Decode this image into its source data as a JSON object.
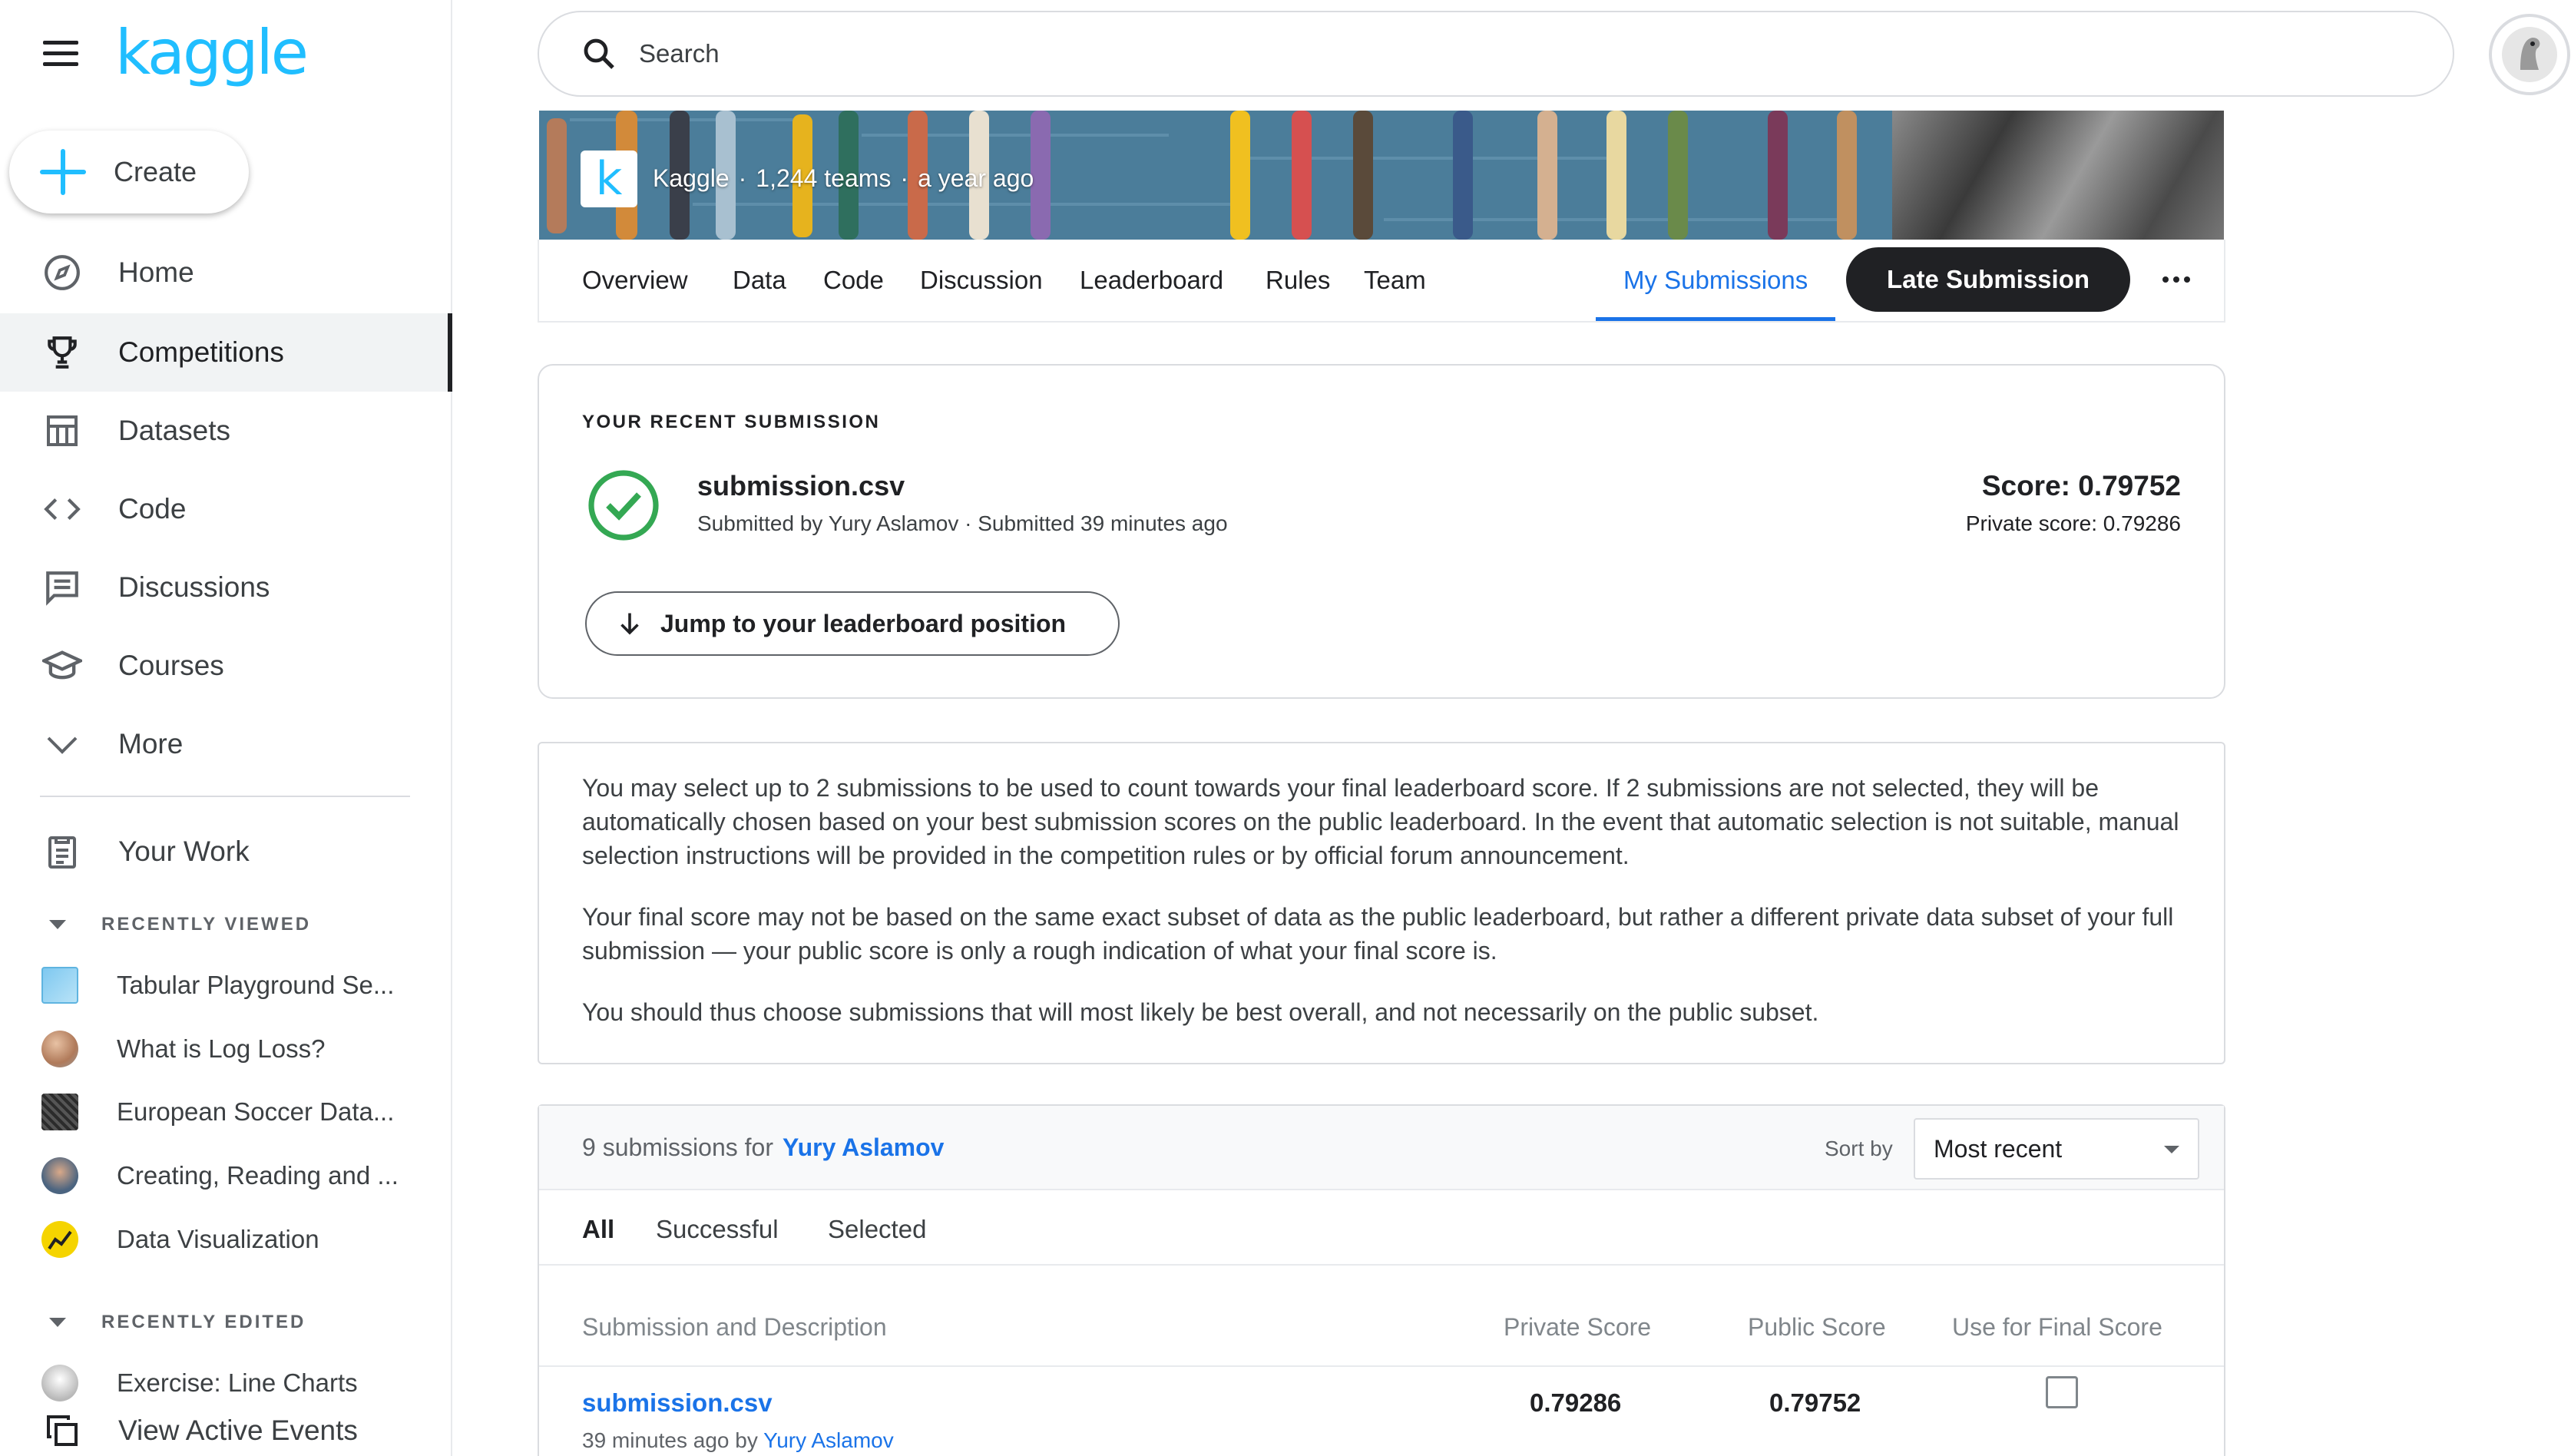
{
  "sidebar": {
    "logo": "kaggle",
    "create_label": "Create",
    "nav": [
      {
        "label": "Home",
        "icon": "compass-icon"
      },
      {
        "label": "Competitions",
        "icon": "trophy-icon",
        "active": true
      },
      {
        "label": "Datasets",
        "icon": "table-icon"
      },
      {
        "label": "Code",
        "icon": "code-icon"
      },
      {
        "label": "Discussions",
        "icon": "comments-icon"
      },
      {
        "label": "Courses",
        "icon": "school-icon"
      },
      {
        "label": "More",
        "icon": "chevron-down-icon"
      }
    ],
    "your_work": "Your Work",
    "recently_viewed_title": "RECENTLY VIEWED",
    "recently_viewed": [
      "Tabular Playground Se...",
      "What is Log Loss?",
      "European Soccer Data...",
      "Creating, Reading and ...",
      "Data Visualization"
    ],
    "recently_edited_title": "RECENTLY EDITED",
    "recently_edited": [
      "Exercise: Line Charts"
    ],
    "view_active_events": "View Active Events"
  },
  "search": {
    "placeholder": "Search"
  },
  "banner": {
    "host": "Kaggle",
    "sep": "·",
    "teams": "1,244 teams",
    "age": "a year ago"
  },
  "tabs": [
    "Overview",
    "Data",
    "Code",
    "Discussion",
    "Leaderboard",
    "Rules",
    "Team"
  ],
  "tab_selected": "My Submissions",
  "late_submission_label": "Late Submission",
  "recent_submission": {
    "title": "YOUR RECENT SUBMISSION",
    "file": "submission.csv",
    "submitted_by": "Submitted by Yury Aslamov · Submitted 39 minutes ago",
    "score": "Score: 0.79752",
    "private_score": "Private score: 0.79286",
    "jump_label": "Jump to your leaderboard position"
  },
  "info": [
    "You may select up to 2 submissions to be used to count towards your final leaderboard score. If 2 submissions are not selected, they will be automatically chosen based on your best submission scores on the public leaderboard. In the event that automatic selection is not suitable, manual selection instructions will be provided in the competition rules or by official forum announcement.",
    "Your final score may not be based on the same exact subset of data as the public leaderboard, but rather a different private data subset of your full submission — your public score is only a rough indication of what your final score is.",
    "You should thus choose submissions that will most likely be best overall, and not necessarily on the public subset."
  ],
  "submissions": {
    "count_label": "9 submissions for",
    "user": "Yury Aslamov",
    "sort_label": "Sort by",
    "sort_value": "Most recent",
    "filters": [
      "All",
      "Successful",
      "Selected"
    ],
    "columns": [
      "Submission and Description",
      "Private Score",
      "Public Score",
      "Use for Final Score"
    ],
    "rows": [
      {
        "file": "submission.csv",
        "meta": "39 minutes ago by",
        "user": "Yury Aslamov",
        "private": "0.79286",
        "public": "0.79752"
      }
    ]
  },
  "colors": {
    "brand": "#20beff",
    "link": "#1a73e8",
    "success": "#34a853",
    "dark": "#202124"
  }
}
